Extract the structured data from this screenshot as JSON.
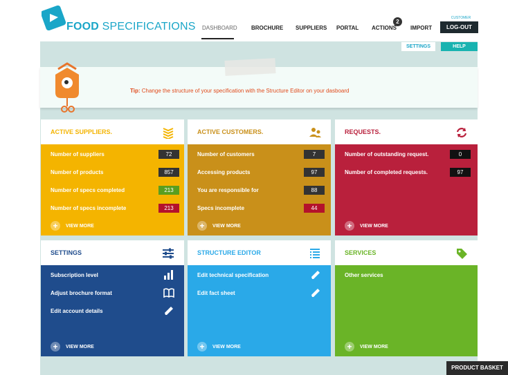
{
  "header": {
    "brand_bold": "FOOD",
    "brand_rest": " SPECIFICATIONS",
    "nav": [
      "DASHBOARD",
      "BROCHURE",
      "SUPPLIERS",
      "PORTAL",
      "ACTIONS",
      "IMPORT"
    ],
    "actions_badge": "2",
    "customer_label": "CUSTOMER",
    "logout_label": "LOG-OUT"
  },
  "subnav": {
    "settings_label": "SETTINGS",
    "help_label": "HELP"
  },
  "tip": {
    "prefix": "Tip:",
    "text": " Change the structure of your specification with the Structure Editor on your dasboard"
  },
  "panels": {
    "suppliers": {
      "title": "ACTIVE SUPPLIERS.",
      "rows": [
        {
          "label": "Number of suppliers",
          "value": "72",
          "color": "#333333"
        },
        {
          "label": "Number of products",
          "value": "857",
          "color": "#333333"
        },
        {
          "label": "Number of specs completed",
          "value": "213",
          "color": "#5a9e1f"
        },
        {
          "label": "Number of specs incomplete",
          "value": "213",
          "color": "#b4122b"
        }
      ],
      "view_more": "VIEW MORE"
    },
    "customers": {
      "title": "ACTIVE CUSTOMERS.",
      "rows": [
        {
          "label": "Number of customers",
          "value": "7",
          "color": "#333333"
        },
        {
          "label": "Accessing products",
          "value": "97",
          "color": "#333333"
        },
        {
          "label": "You are responsible for",
          "value": "88",
          "color": "#333333"
        },
        {
          "label": "Specs incomplete",
          "value": "44",
          "color": "#b4122b"
        }
      ],
      "view_more": "VIEW MORE"
    },
    "requests": {
      "title": "REQUESTS.",
      "rows": [
        {
          "label": "Number of outstanding request.",
          "value": "0",
          "color": "#111111"
        },
        {
          "label": "Number of completed requests.",
          "value": "97",
          "color": "#111111"
        }
      ],
      "view_more": "VIEW MORE"
    },
    "settings": {
      "title": "SETTINGS",
      "rows": [
        {
          "label": "Subscription level",
          "icon": "bar-chart-icon"
        },
        {
          "label": "Adjust brochure format",
          "icon": "book-icon"
        },
        {
          "label": "Edit account details",
          "icon": "pencil-icon"
        }
      ],
      "view_more": "VIEW MORE"
    },
    "structure": {
      "title": "STRUCTURE EDITOR",
      "rows": [
        {
          "label": "Edit technical specification",
          "icon": "pencil-icon"
        },
        {
          "label": "Edit fact sheet",
          "icon": "pencil-icon"
        }
      ],
      "view_more": "VIEW MORE"
    },
    "services": {
      "title": "SERVICES",
      "rows": [
        {
          "label": "Other services"
        }
      ],
      "view_more": "VIEW MORE"
    }
  },
  "product_basket": "PRODUCT BASKET",
  "colors": {
    "accent": "#1aa6c8",
    "suppliers": "#f4b400",
    "customers": "#c9901a",
    "requests": "#b9203c",
    "settings": "#1f4c8c",
    "structure": "#2aa9e8",
    "services": "#6ab427"
  }
}
